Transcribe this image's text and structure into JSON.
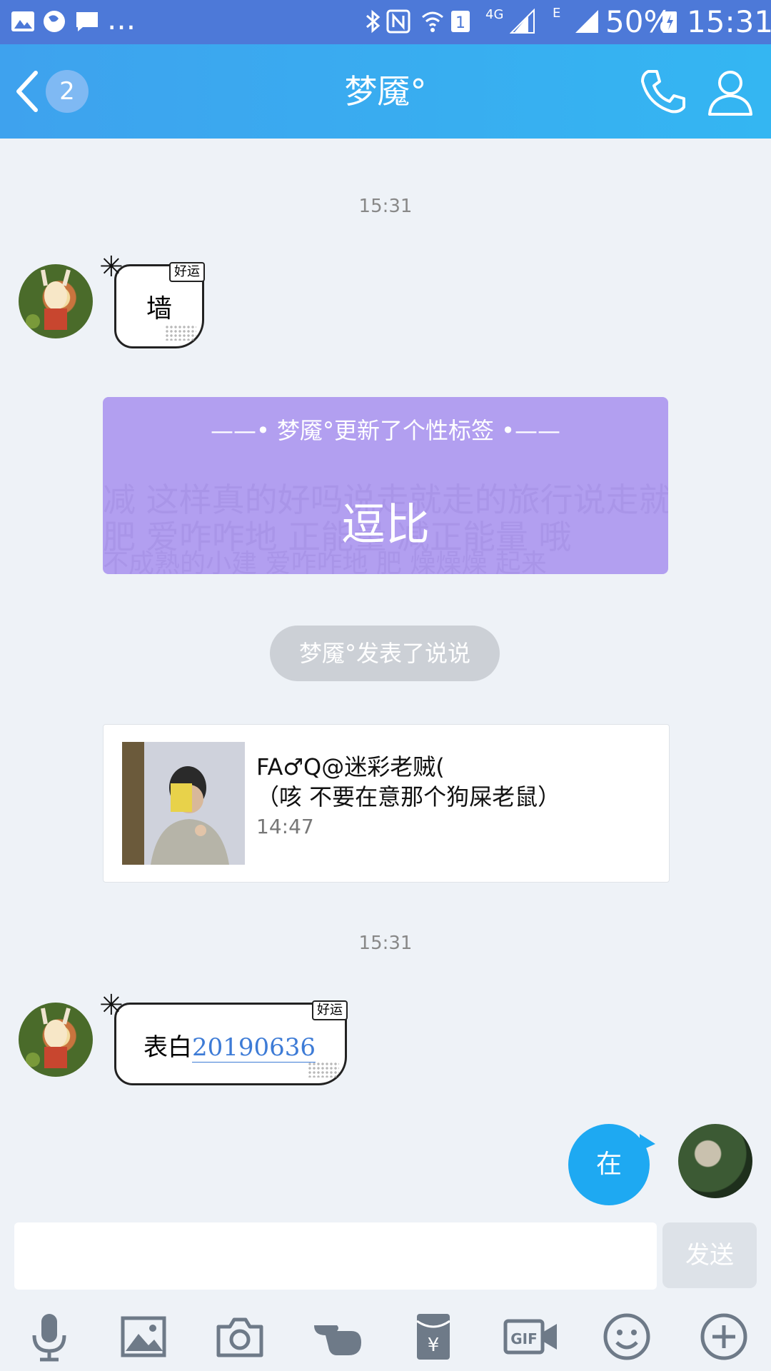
{
  "status_bar": {
    "network_gen": "4G",
    "network_e": "E",
    "battery": "50%",
    "time": "15:31",
    "overflow": "..."
  },
  "header": {
    "unread_count": "2",
    "title": "梦魇°"
  },
  "messages": {
    "time1": "15:31",
    "sticker1": {
      "tag": "好运",
      "text": "墙"
    },
    "signature": {
      "header": "——• 梦魇°更新了个性标签 •——",
      "value": "逗比",
      "bg_line1": "减 这样真的好吗说走就走的旅行说走就走",
      "bg_line2": "肥 爱咋咋地 正能量 减正能量 哦",
      "bg_line3": "不成熟的小建 爱咋咋地 肥 燥燥燥 起来"
    },
    "shuoshuo_notice": "梦魇°发表了说说",
    "feed": {
      "line1": "FA♂Q@迷彩老贼(",
      "line2": "（咳 不要在意那个狗屎老鼠）",
      "time": "14:47"
    },
    "time2": "15:31",
    "sticker2": {
      "tag": "好运",
      "text_prefix": "表白",
      "text_number": "20190636"
    },
    "my_message": "在"
  },
  "input": {
    "placeholder": "",
    "send_label": "发送"
  },
  "colors": {
    "header": "#36aff0",
    "my_bubble": "#1ea9f2",
    "signature_card": "#b29ff0"
  }
}
